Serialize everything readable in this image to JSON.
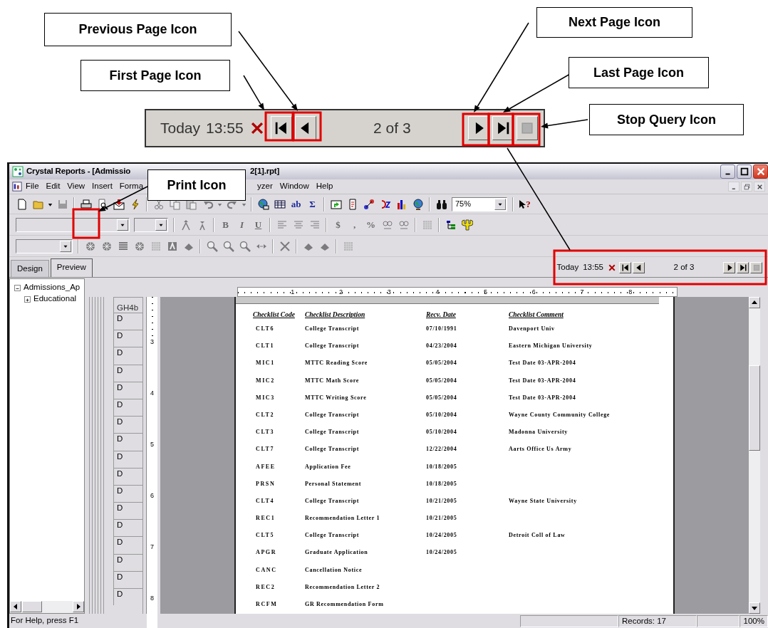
{
  "callouts": [
    "Previous Page Icon",
    "First Page Icon",
    "Next Page Icon",
    "Last Page Icon",
    "Stop Query Icon",
    "Print Icon"
  ],
  "zoomed_navigation": {
    "date_label": "Today",
    "time": "13:55",
    "page": "2 of 3"
  },
  "window": {
    "title_start": "Crystal Reports - [Admissio",
    "title_end": "2[1].rpt]"
  },
  "menu": [
    "File",
    "Edit",
    "View",
    "Insert",
    "Forma",
    "yzer",
    "Window",
    "Help"
  ],
  "toolbar_1": [
    {
      "kind": "new",
      "disabled": false
    },
    {
      "kind": "open",
      "disabled": false
    },
    {
      "kind": "caret",
      "disabled": false
    },
    {
      "kind": "save",
      "disabled": true
    },
    {
      "kind": "sep"
    },
    {
      "kind": "print",
      "disabled": false
    },
    {
      "kind": "preview",
      "disabled": false
    },
    {
      "kind": "export",
      "disabled": false
    },
    {
      "kind": "lightning",
      "disabled": false
    },
    {
      "kind": "sep"
    },
    {
      "kind": "cut",
      "disabled": true
    },
    {
      "kind": "copy",
      "disabled": true
    },
    {
      "kind": "paste",
      "disabled": true
    },
    {
      "kind": "undo",
      "disabled": true
    },
    {
      "kind": "caret",
      "disabled": true
    },
    {
      "kind": "redo",
      "disabled": true
    },
    {
      "kind": "caret",
      "disabled": true
    },
    {
      "kind": "sep"
    },
    {
      "kind": "database",
      "disabled": false
    },
    {
      "kind": "table",
      "disabled": false
    },
    {
      "kind": "text",
      "label": "ab",
      "disabled": false
    },
    {
      "kind": "text",
      "label": "Σ",
      "disabled": false
    },
    {
      "kind": "sep"
    },
    {
      "kind": "folder-arrow",
      "disabled": false
    },
    {
      "kind": "document",
      "disabled": false
    },
    {
      "kind": "nodes",
      "disabled": false
    },
    {
      "kind": "sort",
      "disabled": false
    },
    {
      "kind": "chart",
      "disabled": false
    },
    {
      "kind": "globe",
      "disabled": false
    },
    {
      "kind": "sep"
    },
    {
      "kind": "binoculars",
      "disabled": false
    },
    {
      "kind": "zoom-combo",
      "value": "75%",
      "disabled": false
    },
    {
      "kind": "sep"
    },
    {
      "kind": "help",
      "label": "?",
      "disabled": false
    }
  ],
  "toolbar_2": [
    {
      "kind": "font-combo",
      "disabled": true
    },
    {
      "kind": "size-combo",
      "disabled": true
    },
    {
      "kind": "sep"
    },
    {
      "kind": "grow",
      "disabled": true
    },
    {
      "kind": "shrink",
      "disabled": true
    },
    {
      "kind": "sep"
    },
    {
      "kind": "bold",
      "label": "B",
      "disabled": true
    },
    {
      "kind": "italic",
      "label": "I",
      "disabled": true
    },
    {
      "kind": "underline",
      "label": "U",
      "disabled": true
    },
    {
      "kind": "sep"
    },
    {
      "kind": "align-left",
      "disabled": true
    },
    {
      "kind": "align-center",
      "disabled": true
    },
    {
      "kind": "align-right",
      "disabled": true
    },
    {
      "kind": "sep"
    },
    {
      "kind": "text",
      "label": "$",
      "disabled": true
    },
    {
      "kind": "text",
      "label": ",",
      "disabled": true
    },
    {
      "kind": "text",
      "label": "%",
      "disabled": true
    },
    {
      "kind": "decimal",
      "disabled": true
    },
    {
      "kind": "decimal",
      "disabled": true
    },
    {
      "kind": "sep"
    },
    {
      "kind": "grid",
      "disabled": true
    },
    {
      "kind": "sep"
    },
    {
      "kind": "tree",
      "disabled": false
    },
    {
      "kind": "wrench",
      "disabled": false
    }
  ],
  "toolbar_3": [
    {
      "kind": "style-combo",
      "disabled": true
    },
    {
      "kind": "sep"
    },
    {
      "kind": "burst",
      "disabled": true
    },
    {
      "kind": "burst",
      "disabled": true
    },
    {
      "kind": "rows",
      "disabled": true
    },
    {
      "kind": "burst",
      "disabled": true
    },
    {
      "kind": "grid",
      "disabled": true
    },
    {
      "kind": "frame",
      "disabled": true
    },
    {
      "kind": "stack",
      "disabled": true
    },
    {
      "kind": "sep"
    },
    {
      "kind": "zoom",
      "disabled": true
    },
    {
      "kind": "zoom",
      "disabled": true
    },
    {
      "kind": "zoom",
      "disabled": true
    },
    {
      "kind": "resize",
      "disabled": true
    },
    {
      "kind": "sep"
    },
    {
      "kind": "cross",
      "disabled": true
    },
    {
      "kind": "sep"
    },
    {
      "kind": "stack",
      "disabled": true
    },
    {
      "kind": "stack",
      "disabled": true
    },
    {
      "kind": "sep"
    },
    {
      "kind": "grid",
      "disabled": true
    }
  ],
  "tabs": [
    {
      "label": "Design",
      "selected": false
    },
    {
      "label": "Preview",
      "selected": true
    }
  ],
  "navigation": {
    "date_label": "Today",
    "time": "13:55",
    "page": "2 of 3"
  },
  "tree": [
    {
      "label": "Admissions_Ap",
      "expanded": true,
      "children": [
        {
          "label": "Educational",
          "expanded": false
        }
      ]
    }
  ],
  "sections": [
    "GH4b",
    "D",
    "D",
    "D",
    "D",
    "D",
    "D",
    "D",
    "D",
    "D",
    "D",
    "D",
    "D",
    "D",
    "D",
    "D",
    "D",
    "D"
  ],
  "ruler_h": [
    "1",
    "2",
    "3",
    "4",
    "5",
    "6",
    "7",
    "8"
  ],
  "ruler_v": [
    "3",
    "4",
    "5",
    "6",
    "7",
    "8"
  ],
  "report": {
    "columns": [
      "Checklist Code",
      "Checklist Description",
      "Recv. Date",
      "Checklist Comment"
    ],
    "rows": [
      [
        "CLT6",
        "College Transcript",
        "07/10/1991",
        "Davenport Univ"
      ],
      [
        "CLT1",
        "College Transcript",
        "04/23/2004",
        "Eastern Michigan University"
      ],
      [
        "MIC1",
        "MTTC Reading Score",
        "05/05/2004",
        "Test Date 03-APR-2004"
      ],
      [
        "MIC2",
        "MTTC Math Score",
        "05/05/2004",
        "Test Date 03-APR-2004"
      ],
      [
        "MIC3",
        "MTTC Writing Score",
        "05/05/2004",
        "Test Date 03-APR-2004"
      ],
      [
        "CLT2",
        "College Transcript",
        "05/10/2004",
        "Wayne County Community College"
      ],
      [
        "CLT3",
        "College Transcript",
        "05/10/2004",
        "Madonna University"
      ],
      [
        "CLT7",
        "College Transcript",
        "12/22/2004",
        "Aarts Office Us Army"
      ],
      [
        "AFEE",
        "Application Fee",
        "10/18/2005",
        ""
      ],
      [
        "PRSN",
        "Personal Statement",
        "10/18/2005",
        ""
      ],
      [
        "CLT4",
        "College Transcript",
        "10/21/2005",
        "Wayne State University"
      ],
      [
        "REC1",
        "Recommendation Letter 1",
        "10/21/2005",
        ""
      ],
      [
        "CLT5",
        "College Transcript",
        "10/24/2005",
        "Detroit Coll of Law"
      ],
      [
        "APGR",
        "Graduate Application",
        "10/24/2005",
        ""
      ],
      [
        "CANC",
        "Cancellation Notice",
        "",
        ""
      ],
      [
        "REC2",
        "Recommendation Letter 2",
        "",
        ""
      ],
      [
        "RCFM",
        "GR Recommendation Form",
        "",
        ""
      ]
    ]
  },
  "status_bar": {
    "help": "For Help, press F1",
    "records": "Records:  17",
    "zoom": "100%"
  }
}
